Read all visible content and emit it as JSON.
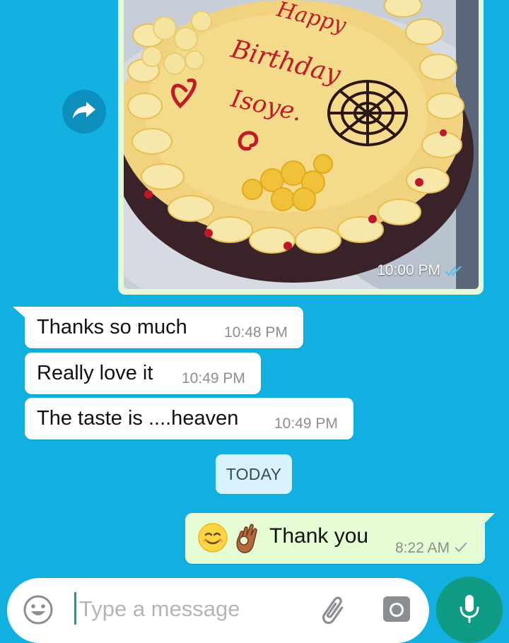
{
  "image_message": {
    "time": "10:00 PM",
    "status": "double-check-icon",
    "cake_text_line1": "Happy",
    "cake_text_line2": "Birthday",
    "cake_text_line3": "Isoye."
  },
  "incoming_messages": [
    {
      "text": "Thanks so much",
      "time": "10:48 PM"
    },
    {
      "text": "Really love it",
      "time": "10:49 PM"
    },
    {
      "text": "The taste is ....heaven",
      "time": "10:49 PM"
    }
  ],
  "date_divider": "TODAY",
  "outgoing_message": {
    "text": "Thank you",
    "time": "8:22 AM",
    "emojis": [
      "smiling-face-emoji",
      "ok-hand-emoji"
    ]
  },
  "composer": {
    "placeholder": "Type a message"
  },
  "colors": {
    "background": "#12b0e0",
    "outgoing_bubble": "#e5fbd3",
    "incoming_bubble": "#ffffff",
    "mic_button": "#0f9b84",
    "read_tick": "#4fc3f7"
  }
}
